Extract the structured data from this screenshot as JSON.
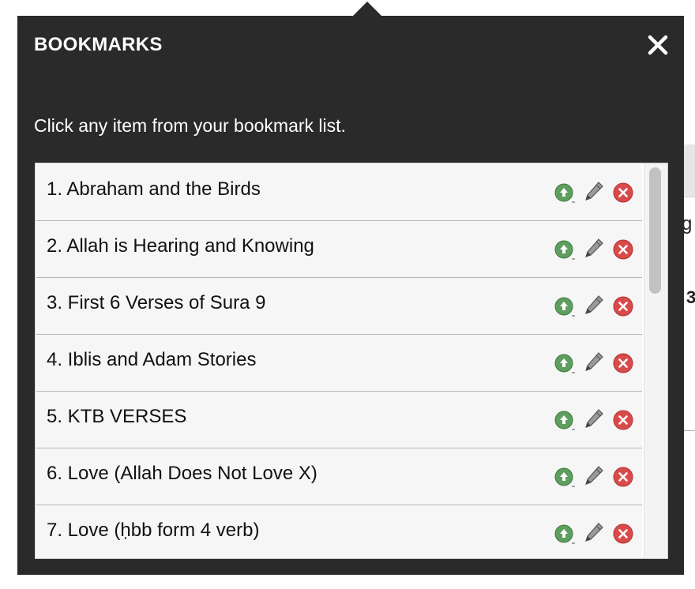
{
  "popover": {
    "title": "BOOKMARKS",
    "instructions": "Click any item from your bookmark list."
  },
  "background_fragments": {
    "text1": "g",
    "text2": "3"
  },
  "icons": {
    "close": "close-icon",
    "move_up": "arrow-up-circle-icon",
    "edit": "pencil-icon",
    "delete": "delete-x-circle-icon"
  },
  "colors": {
    "panel": "#2a2a2a",
    "move_up": "#5e9e5e",
    "delete": "#d94a4a"
  },
  "bookmarks": [
    {
      "label": "1. Abraham and the Birds"
    },
    {
      "label": "2. Allah is Hearing and Knowing"
    },
    {
      "label": "3. First 6 Verses of Sura 9"
    },
    {
      "label": "4. Iblis and Adam Stories"
    },
    {
      "label": "5. KTB VERSES"
    },
    {
      "label": "6. Love (Allah Does Not Love X)"
    },
    {
      "label": "7. Love (ḥbb form 4 verb)"
    }
  ]
}
